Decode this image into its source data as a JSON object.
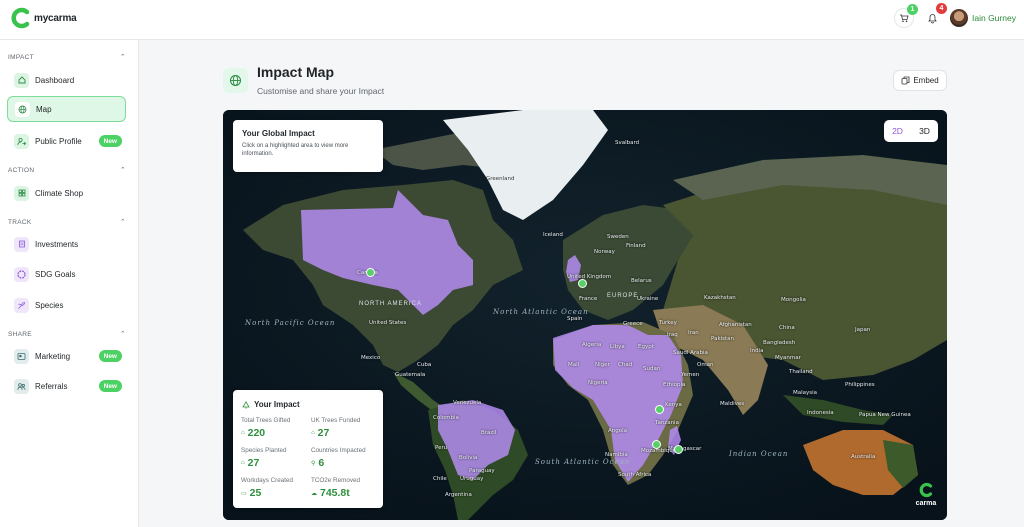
{
  "app": {
    "brand": "mycarma",
    "cart_badge": "1",
    "notification_badge": "4",
    "user_name": "Iain Gurney"
  },
  "sidebar": {
    "sections": [
      {
        "label": "IMPACT"
      },
      {
        "label": "ACTION"
      },
      {
        "label": "TRACK"
      },
      {
        "label": "SHARE"
      }
    ],
    "items": [
      {
        "label": "Dashboard",
        "icon": "home-icon"
      },
      {
        "label": "Map",
        "icon": "globe-icon",
        "active": true
      },
      {
        "label": "Public Profile",
        "icon": "user-share-icon",
        "badge": "New"
      },
      {
        "label": "Climate Shop",
        "icon": "grid-icon"
      },
      {
        "label": "Investments",
        "icon": "document-icon"
      },
      {
        "label": "SDG Goals",
        "icon": "sdg-icon"
      },
      {
        "label": "Species",
        "icon": "species-icon"
      },
      {
        "label": "Marketing",
        "icon": "marketing-icon",
        "badge": "New"
      },
      {
        "label": "Referrals",
        "icon": "referrals-icon",
        "badge": "New"
      }
    ]
  },
  "header": {
    "title": "Impact Map",
    "subtitle": "Customise and share your Impact",
    "embed_label": "Embed"
  },
  "map": {
    "global_impact_title": "Your Global Impact",
    "global_impact_text": "Click on a highlighted area to view more information.",
    "toggle_2d": "2D",
    "toggle_3d": "3D",
    "watermark": "carma",
    "highlight_color": "#b48cf2",
    "marker_color": "#58d068",
    "oceans": [
      {
        "text": "North Pacific Ocean"
      },
      {
        "text": "North Atlantic Ocean"
      },
      {
        "text": "South Atlantic Ocean"
      },
      {
        "text": "Indian Ocean"
      }
    ],
    "regions": [
      {
        "text": "NORTH AMERICA"
      },
      {
        "text": "EUROPE"
      }
    ],
    "places": [
      "Greenland",
      "Sweden",
      "Finland",
      "Norway",
      "United Kingdom",
      "France",
      "Spain",
      "Belarus",
      "Ukraine",
      "Greece",
      "Turkey",
      "Kazakhstan",
      "Mongolia",
      "China",
      "Japan",
      "Afghanistan",
      "Pakistan",
      "India",
      "Iran",
      "Iraq",
      "Saudi Arabia",
      "Egypt",
      "Algeria",
      "Libya",
      "Mali",
      "Niger",
      "Chad",
      "Sudan",
      "Nigeria",
      "Ethiopia",
      "Kenya",
      "Tanzania",
      "Madagascar",
      "Angola",
      "Namibia",
      "Mozambique",
      "South Africa",
      "Australia",
      "Indonesia",
      "Philippines",
      "Thailand",
      "Malaysia",
      "Papua New Guinea",
      "Mexico",
      "United States",
      "Canada",
      "Venezuela",
      "Colombia",
      "Peru",
      "Bolivia",
      "Brazil",
      "Paraguay",
      "Uruguay",
      "Argentina",
      "Chile",
      "Cuba",
      "Iceland",
      "Maldives",
      "Svalbard",
      "Myanmar",
      "Bangladesh",
      "Guatemala",
      "Oman",
      "Yemen"
    ]
  },
  "impact": {
    "title": "Your Impact",
    "stats": [
      {
        "label": "Total Trees Gifted",
        "value": "220",
        "icon": "tree-icon"
      },
      {
        "label": "UK Trees Funded",
        "value": "27",
        "icon": "tree-icon"
      },
      {
        "label": "Species Planted",
        "value": "27",
        "icon": "tree-icon"
      },
      {
        "label": "Countries Impacted",
        "value": "6",
        "icon": "pin-icon"
      },
      {
        "label": "Workdays Created",
        "value": "25",
        "icon": "calendar-icon"
      },
      {
        "label": "TCO2e Removed",
        "value": "745.8t",
        "icon": "cloud-icon"
      }
    ]
  }
}
